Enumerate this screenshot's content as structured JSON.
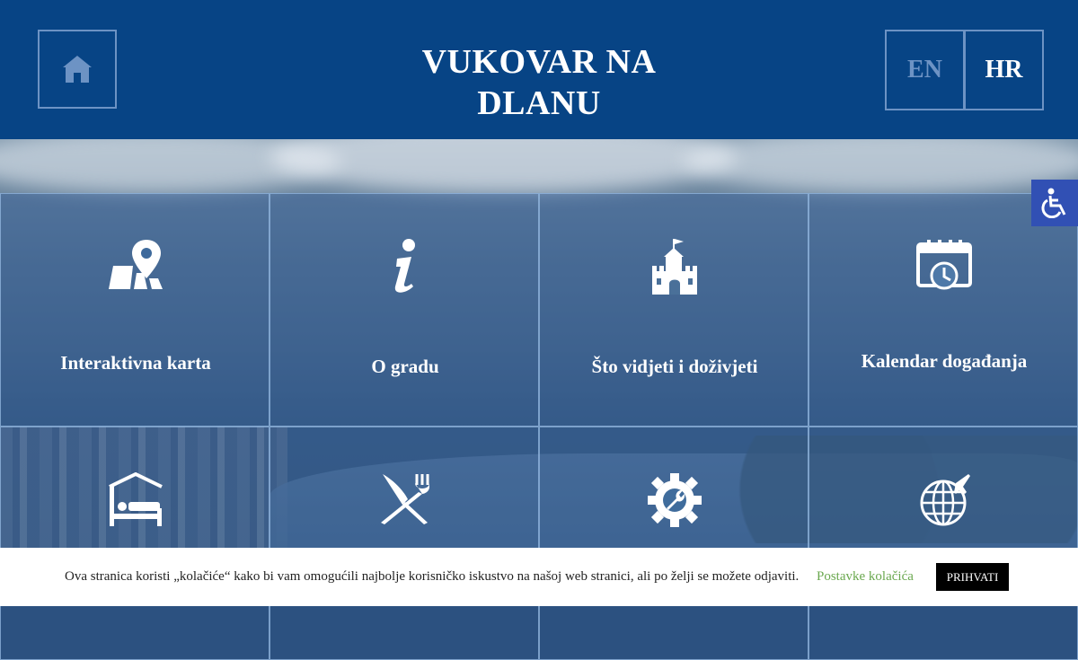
{
  "header": {
    "title_line1": "VUKOVAR NA",
    "title_line2": "DLANU",
    "home_icon": "home-icon",
    "languages": [
      {
        "code": "EN",
        "active": false
      },
      {
        "code": "HR",
        "active": true
      }
    ]
  },
  "tiles": [
    {
      "label": "Interaktivna karta",
      "icon": "map-pin-icon"
    },
    {
      "label": "O gradu",
      "icon": "info-icon"
    },
    {
      "label": "Što vidjeti i doživjeti",
      "icon": "castle-icon"
    },
    {
      "label": "Kalendar događanja",
      "icon": "calendar-clock-icon"
    },
    {
      "label": "",
      "icon": "bed-icon"
    },
    {
      "label": "",
      "icon": "fork-knife-icon"
    },
    {
      "label": "",
      "icon": "gear-wrench-icon"
    },
    {
      "label": "",
      "icon": "globe-plane-icon"
    }
  ],
  "accessibility": {
    "icon": "wheelchair-icon"
  },
  "cookie_bar": {
    "text": "Ova stranica koristi „kolačiće“ kako bi vam omogućili najbolje korisničko iskustvo na našoj web stranici, ali po želji se možete odjaviti.",
    "settings_label": "Postavke kolačića",
    "accept_label": "PRIHVATI"
  },
  "colors": {
    "header_bg": "#074485",
    "border": "#6d93c4",
    "settings_link": "#6aa84f",
    "accessibility_bg": "#3150b4"
  }
}
